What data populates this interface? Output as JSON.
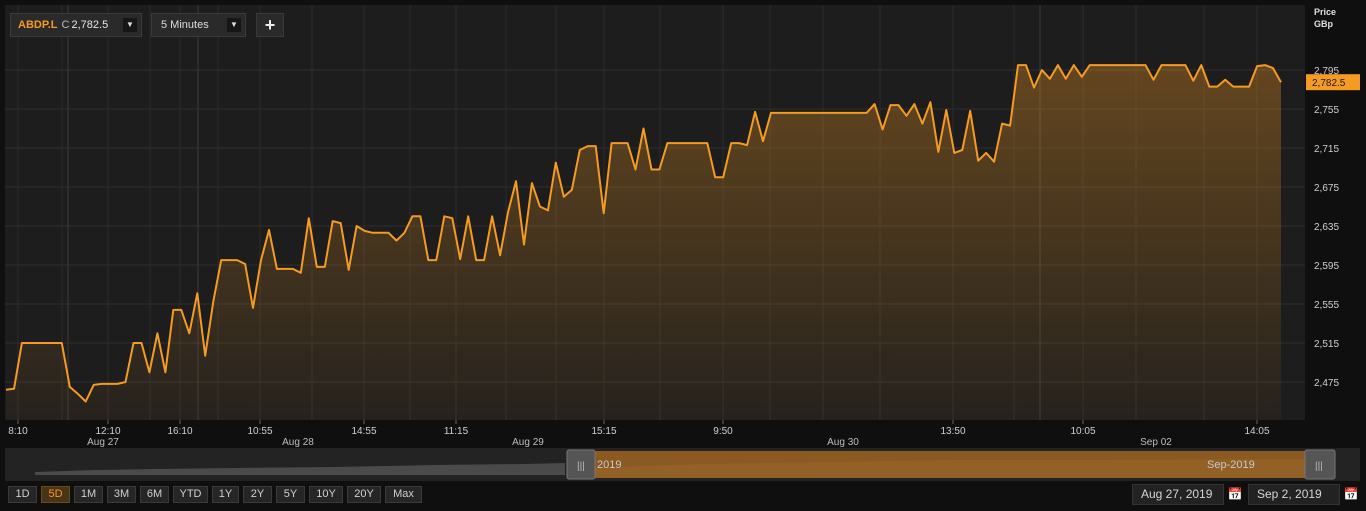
{
  "toolbar": {
    "symbol": "ABDP.L",
    "price_prefix": "C",
    "price": "2,782.5",
    "interval": "5 Minutes",
    "caret": "▼",
    "add_label": "+"
  },
  "price_axis": {
    "title": "Price",
    "unit": "GBp"
  },
  "range_buttons": [
    "1D",
    "5D",
    "1M",
    "3M",
    "6M",
    "YTD",
    "1Y",
    "2Y",
    "5Y",
    "10Y",
    "20Y",
    "Max"
  ],
  "active_range": "5D",
  "navigator": {
    "left_label": "2019",
    "right_label": "Sep-2019"
  },
  "date_range": {
    "start": "Aug 27, 2019",
    "end": "Sep 2, 2019"
  },
  "colors": {
    "line": "#f59a23",
    "badge": "#f59a23",
    "background": "#1d1d1d",
    "grid": "#2e2e2e"
  },
  "chart_data": {
    "type": "area",
    "title": "",
    "ylabel": "Price GBp",
    "ylim": [
      2445,
      2815
    ],
    "yticks": [
      2475,
      2515,
      2555,
      2595,
      2635,
      2675,
      2715,
      2755,
      2795
    ],
    "ytick_labels": [
      "2,475",
      "2,515",
      "2,555",
      "2,595",
      "2,635",
      "2,675",
      "2,715",
      "2,755",
      "2,795"
    ],
    "last_value": 2782.5,
    "last_value_label": "2,782.5",
    "x_time_labels": [
      "8:10",
      "12:10",
      "16:10",
      "10:55",
      "14:55",
      "11:15",
      "15:15",
      "9:50",
      "13:50",
      "10:05",
      "14:05"
    ],
    "x_day_labels": [
      "Aug 27",
      "Aug 28",
      "Aug 29",
      "Aug 30",
      "Sep 02"
    ],
    "series": [
      {
        "values": [
          2467,
          2468,
          2515,
          2515,
          2515,
          2515,
          2515,
          2515,
          2470,
          2463,
          2455,
          2472,
          2473,
          2473,
          2473,
          2475,
          2515,
          2515,
          2485,
          2525,
          2485,
          2549,
          2549,
          2525,
          2566,
          2502,
          2557,
          2600,
          2600,
          2600,
          2596,
          2551,
          2600,
          2631,
          2591,
          2591,
          2591,
          2587,
          2643,
          2593,
          2593,
          2640,
          2638,
          2590,
          2635,
          2630,
          2628,
          2628,
          2628,
          2620,
          2628,
          2645,
          2645,
          2600,
          2600,
          2645,
          2643,
          2601,
          2645,
          2600,
          2600,
          2645,
          2605,
          2649,
          2681,
          2616,
          2679,
          2655,
          2651,
          2700,
          2665,
          2672,
          2713,
          2717,
          2717,
          2648,
          2720,
          2720,
          2720,
          2693,
          2735,
          2693,
          2693,
          2720,
          2720,
          2720,
          2720,
          2720,
          2720,
          2685,
          2685,
          2720,
          2720,
          2718,
          2752,
          2722,
          2751,
          2751,
          2751,
          2751,
          2751,
          2751,
          2751,
          2751,
          2751,
          2751,
          2751,
          2751,
          2751,
          2760,
          2734,
          2759,
          2759,
          2748,
          2760,
          2740,
          2762,
          2711,
          2754,
          2710,
          2713,
          2753,
          2702,
          2710,
          2701,
          2740,
          2738,
          2800,
          2800,
          2777,
          2795,
          2786,
          2800,
          2786,
          2800,
          2788,
          2800,
          2800,
          2800,
          2800,
          2800,
          2800,
          2800,
          2800,
          2785,
          2800,
          2800,
          2800,
          2800,
          2784,
          2800,
          2778,
          2778,
          2785,
          2778,
          2778,
          2778,
          2799,
          2800,
          2797,
          2782.5
        ]
      }
    ]
  }
}
